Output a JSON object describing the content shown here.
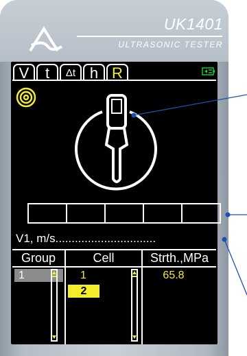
{
  "device": {
    "model": "UK1401",
    "subtitle": "ULTRASONIC TESTER"
  },
  "tabs": [
    {
      "label": "V",
      "active": false
    },
    {
      "label": "t",
      "active": false
    },
    {
      "label": "Δt",
      "active": false
    },
    {
      "label": "h",
      "active": false
    },
    {
      "label": "R",
      "active": true
    }
  ],
  "icons": {
    "logo": "logo-icon",
    "battery": "battery-icon",
    "sensor": "sensor-rings-icon",
    "probe": "probe-icon"
  },
  "segment_bar": {
    "segments": 5
  },
  "velocity": {
    "label": "V1, m/s",
    "value": "..............................."
  },
  "table": {
    "headers": {
      "group": "Group",
      "cell": "Cell",
      "strength": "Strth.,MPa"
    },
    "group_value": "1",
    "cell_values": [
      "1",
      "2"
    ],
    "strength_value": "65.8"
  },
  "colors": {
    "accent": "#f4ee2a",
    "screen": "#000000",
    "callout": "#1f4fb0",
    "battery": "#19c43b"
  }
}
